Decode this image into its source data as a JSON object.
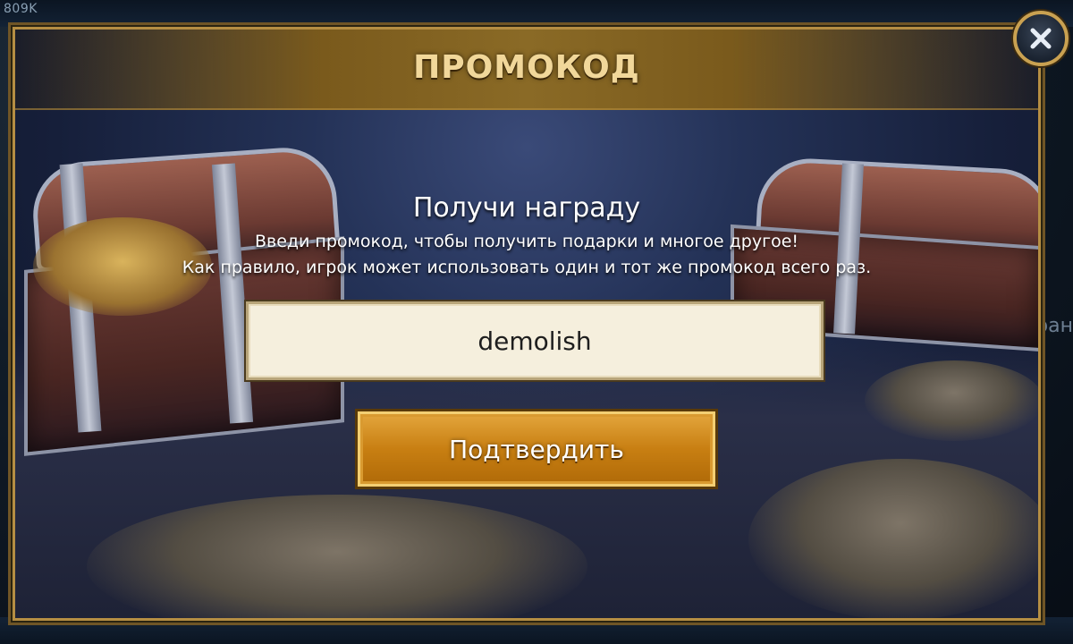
{
  "background": {
    "resource_counter": "809K",
    "side_text": "ран"
  },
  "dialog": {
    "title": "ПРОМОКОД",
    "subtitle": "Получи награду",
    "description_line1": "Введи промокод, чтобы получить подарки и многое другое!",
    "description_line2": "Как правило, игрок может использовать один и тот же промокод всего раз.",
    "promo_input_value": "demolish",
    "confirm_label": "Подтвердить",
    "close_icon": "close-icon"
  },
  "colors": {
    "title_gold": "#f1d79a",
    "button_orange": "#c87f12",
    "frame_gold": "#b58e43",
    "input_bg": "#f5efdd"
  }
}
